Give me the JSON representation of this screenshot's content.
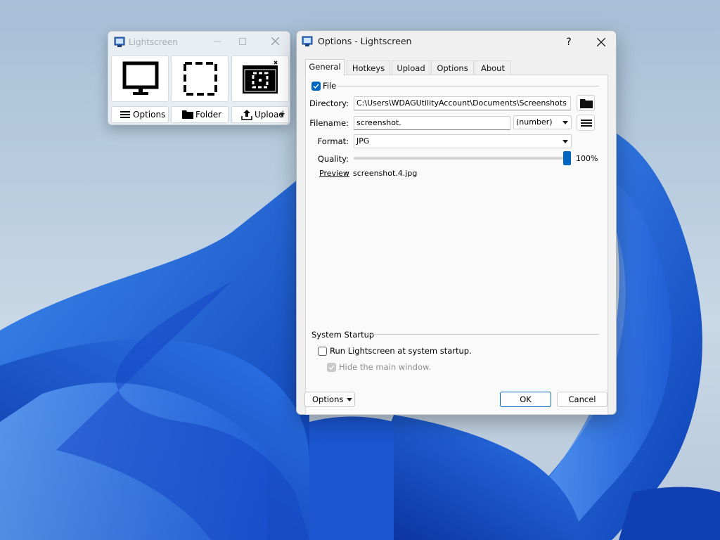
{
  "mini_window": {
    "title": "Lightscreen",
    "buttons": {
      "options": "Options",
      "folder": "Folder",
      "upload": "Upload"
    }
  },
  "dialog": {
    "title": "Options - Lightscreen",
    "help": "?",
    "tabs": [
      "General",
      "Hotkeys",
      "Upload",
      "Options",
      "About"
    ],
    "active_tab": "General",
    "file_group": {
      "label": "File",
      "checked": true,
      "directory_label": "Directory:",
      "directory_value": "C:\\Users\\WDAGUtilityAccount\\Documents\\Screenshots",
      "filename_label": "Filename:",
      "filename_value": "screenshot.",
      "naming_selected": "(number)",
      "format_label": "Format:",
      "format_selected": "JPG",
      "quality_label": "Quality:",
      "quality_value": 100,
      "quality_text": "100%",
      "preview_label": "Preview",
      "preview_colon": ":",
      "preview_value": "screenshot.4.jpg"
    },
    "startup_group": {
      "label": "System Startup",
      "run_at_startup": "Run Lightscreen at system startup.",
      "run_checked": false,
      "hide_main_window": "Hide the main window.",
      "hide_checked": true,
      "hide_enabled": false
    },
    "footer": {
      "options": "Options",
      "ok": "OK",
      "cancel": "Cancel"
    }
  },
  "colors": {
    "accent": "#0067c0",
    "desktop_blue": "#1a5fd6"
  }
}
